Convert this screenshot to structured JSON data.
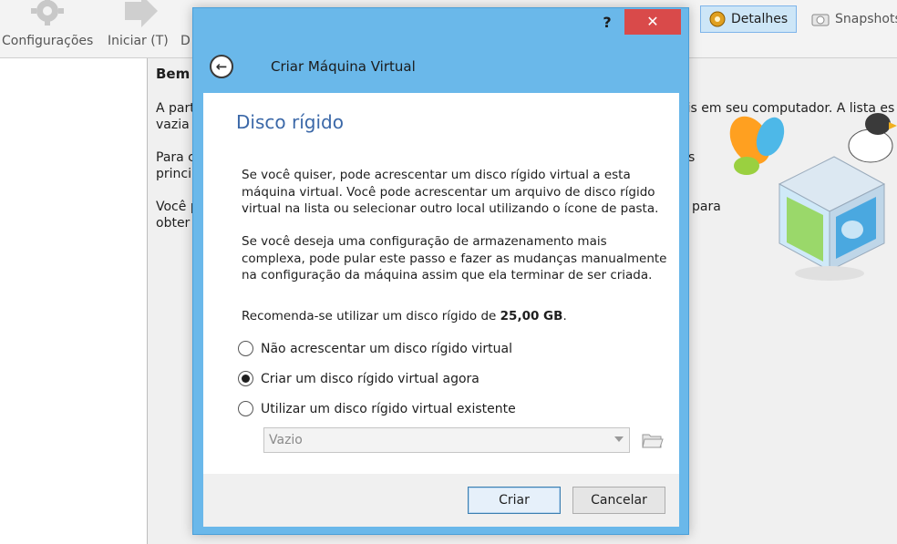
{
  "app": {
    "toolbar": {
      "settings_label": "Configurações",
      "start_label": "Iniciar (T)",
      "discard_label_partial": "D",
      "details_label": "Detalhes",
      "snapshots_label": "Snapshots"
    },
    "main": {
      "welcome_partial": "Bem",
      "lines_left": [
        "A part",
        "vazia",
        "Para c",
        "princip",
        "Você p",
        "obter"
      ],
      "lines_right": [
        "eis em seu computador. A lista es",
        "s",
        "para"
      ]
    }
  },
  "dialog": {
    "help_label": "?",
    "close_label": "✕",
    "title": "Criar Máquina Virtual",
    "page_title": "Disco rígido",
    "paragraph1": "Se você quiser, pode acrescentar um disco rígido virtual a esta máquina virtual. Você pode acrescentar um arquivo de disco rígido virtual na lista ou selecionar outro local utilizando o ícone de pasta.",
    "paragraph2": "Se você deseja uma configuração de armazenamento mais complexa, pode pular este passo e fazer as mudanças manualmente na configuração da máquina assim que ela terminar de ser criada.",
    "recommend_prefix": "Recomenda-se utilizar um disco rígido de ",
    "recommend_size": "25,00 GB",
    "recommend_suffix": ".",
    "options": [
      {
        "label": "Não acrescentar um disco rígido virtual",
        "checked": false
      },
      {
        "label": "Criar um disco rígido virtual agora",
        "checked": true
      },
      {
        "label": "Utilizar um disco rígido virtual existente",
        "checked": false
      }
    ],
    "existing_disk_value": "Vazio",
    "create_button": "Criar",
    "cancel_button": "Cancelar"
  },
  "colors": {
    "dialog_frame": "#6ab8ea",
    "close_button": "#d94a4a",
    "page_title": "#3b68a8"
  }
}
